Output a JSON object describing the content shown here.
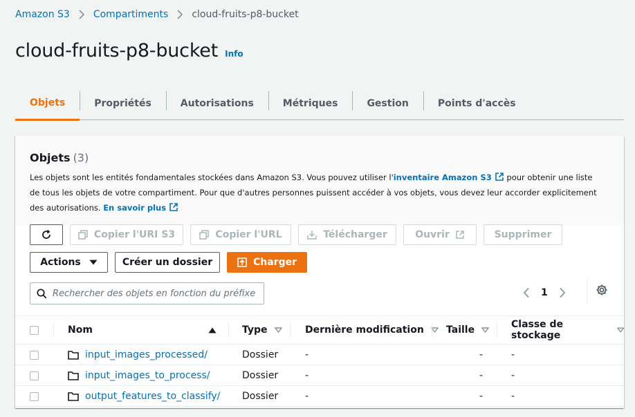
{
  "breadcrumb": {
    "items": [
      "Amazon S3",
      "Compartiments"
    ],
    "current": "cloud-fruits-p8-bucket"
  },
  "page": {
    "title": "cloud-fruits-p8-bucket",
    "info": "Info"
  },
  "tabs": [
    "Objets",
    "Propriétés",
    "Autorisations",
    "Métriques",
    "Gestion",
    "Points d'accès"
  ],
  "active_tab": "Objets",
  "objects": {
    "title": "Objets",
    "count": "(3)",
    "desc_part1": "Les objets sont les entités fondamentales stockées dans Amazon S3. Vous pouvez utiliser l'",
    "desc_link1": "inventaire Amazon S3",
    "desc_part2": " pour obtenir une liste de tous les objets de votre compartiment. Pour que d'autres personnes puissent accéder à vos objets, vous devez leur accorder explicitement des autorisations. ",
    "desc_link2": "En savoir plus"
  },
  "toolbar": {
    "copy_uri": "Copier l'URI S3",
    "copy_url": "Copier l'URL",
    "download": "Télécharger",
    "open": "Ouvrir",
    "delete": "Supprimer",
    "actions": "Actions",
    "create_folder": "Créer un dossier",
    "upload": "Charger"
  },
  "search": {
    "placeholder": "Rechercher des objets en fonction du préfixe"
  },
  "pagination": {
    "page": "1"
  },
  "table": {
    "columns": [
      "Nom",
      "Type",
      "Dernière modification",
      "Taille",
      "Classe de stockage"
    ],
    "rows": [
      {
        "name": "input_images_processed/",
        "type": "Dossier",
        "modified": "-",
        "size": "-",
        "class": "-"
      },
      {
        "name": "input_images_to_process/",
        "type": "Dossier",
        "modified": "-",
        "size": "-",
        "class": "-"
      },
      {
        "name": "output_features_to_classify/",
        "type": "Dossier",
        "modified": "-",
        "size": "-",
        "class": "-"
      }
    ]
  },
  "colors": {
    "accent": "#ec7211",
    "link": "#0073bb"
  }
}
